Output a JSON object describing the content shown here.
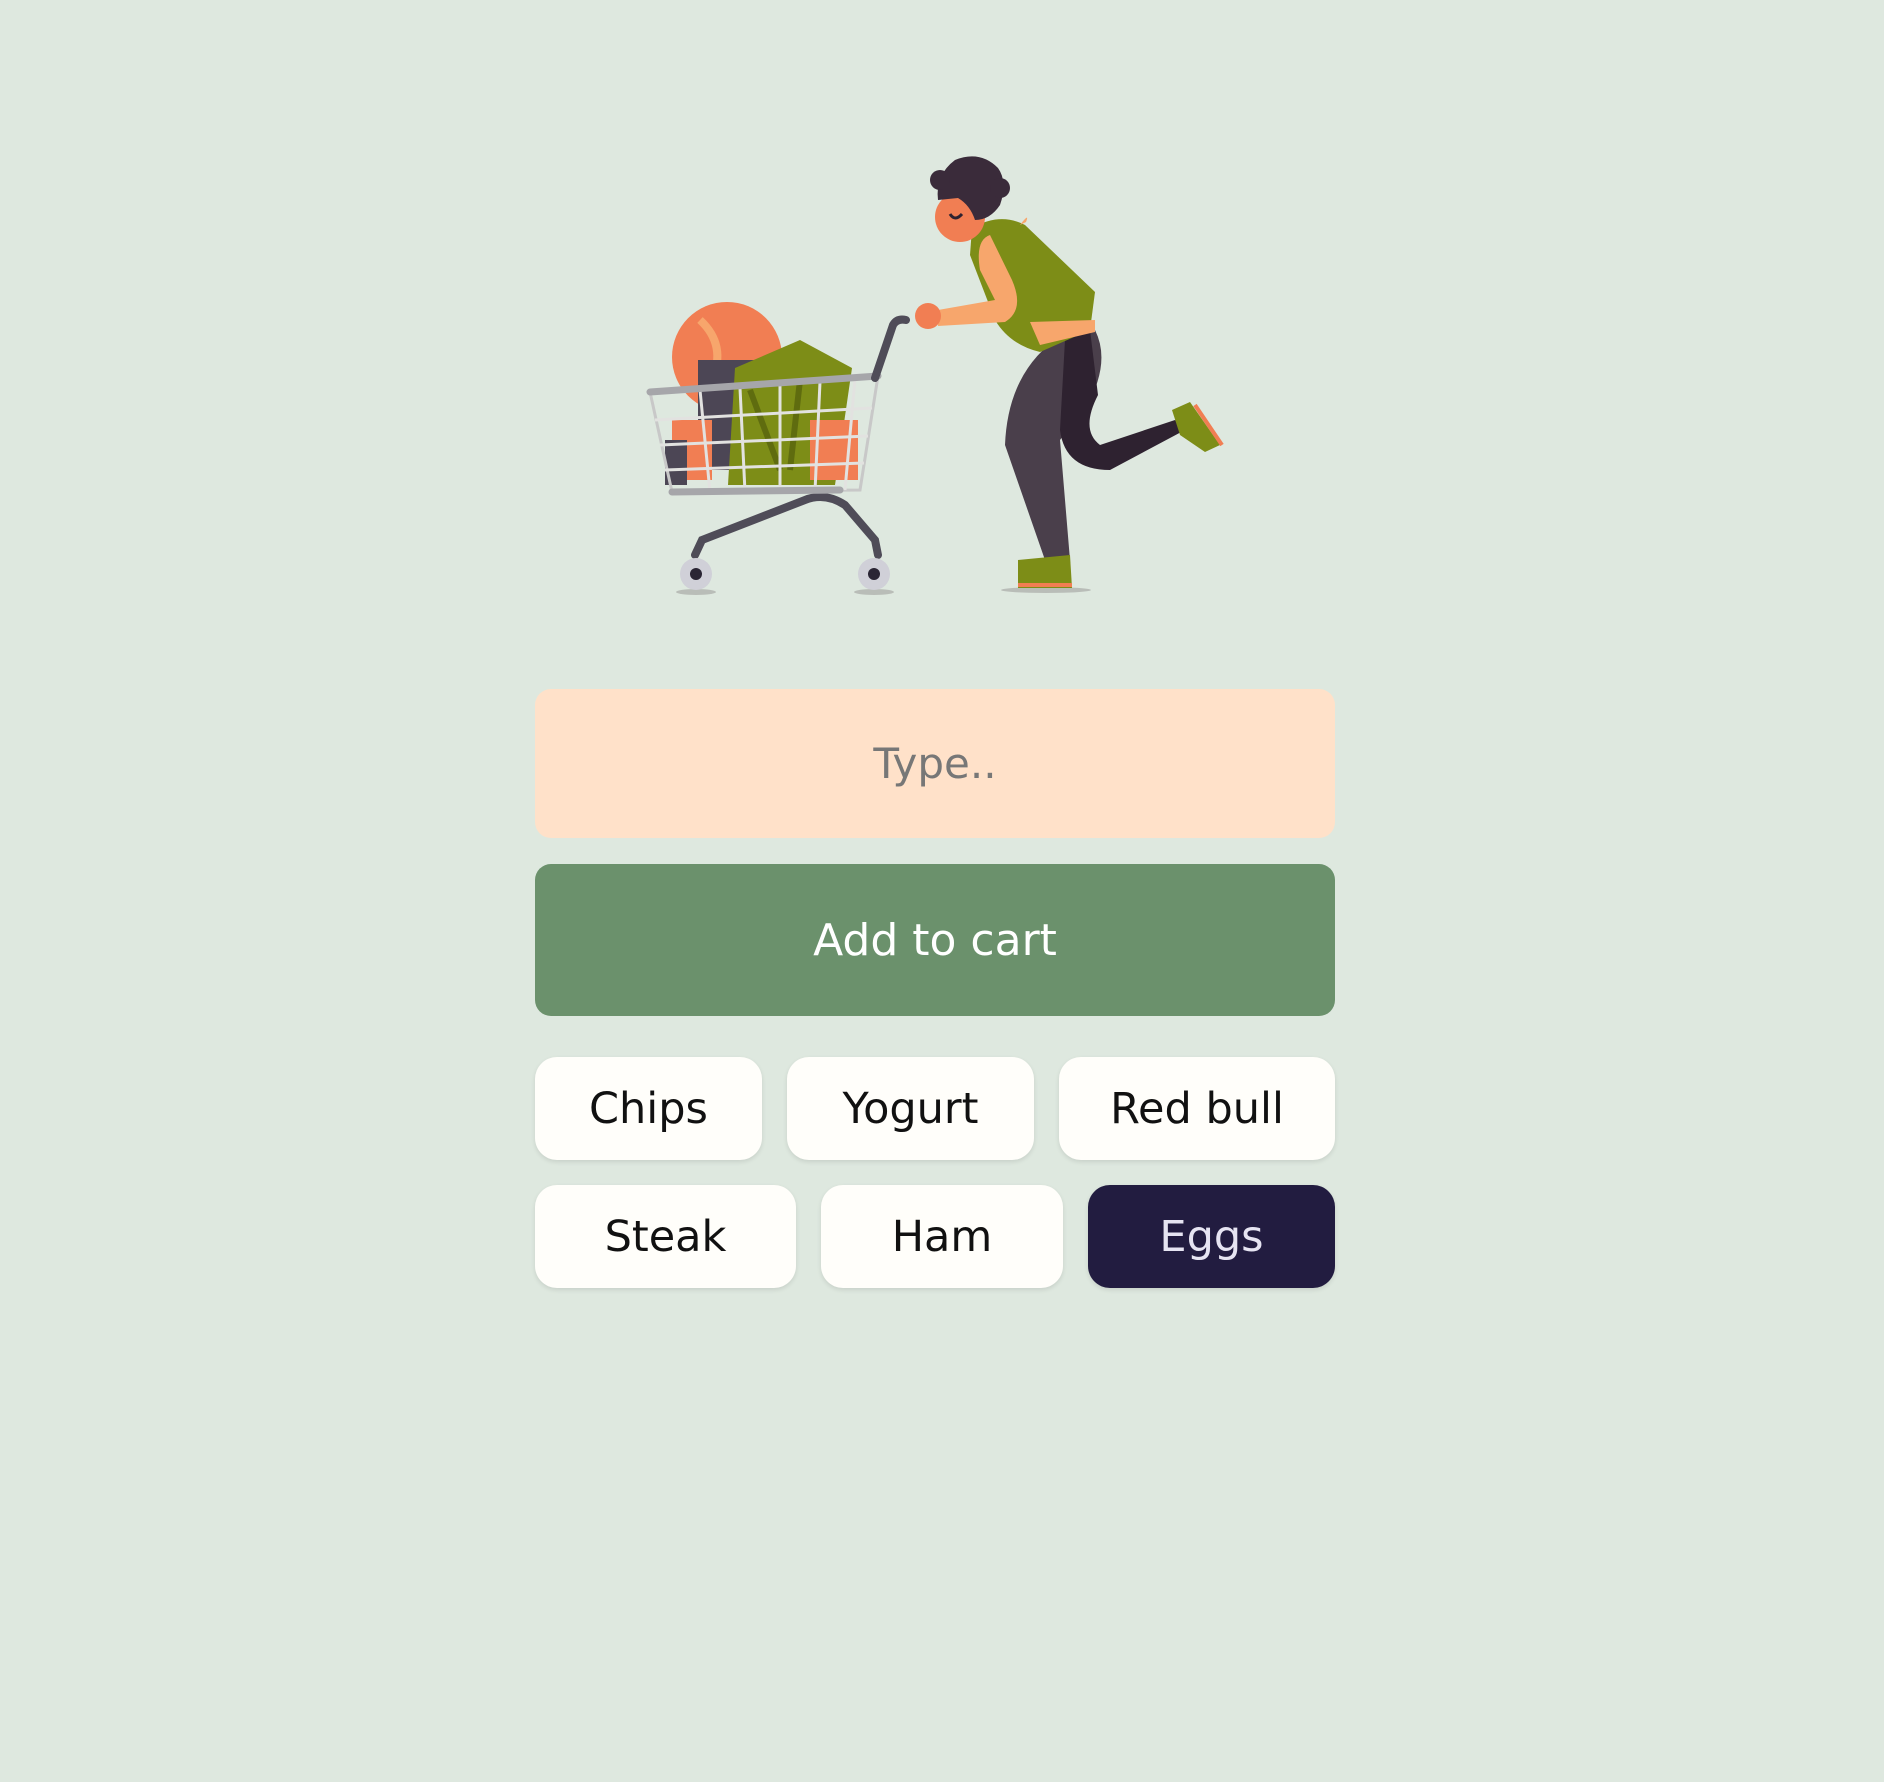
{
  "form": {
    "input_placeholder": "Type..",
    "input_value": "",
    "add_button_label": "Add to cart"
  },
  "items": [
    {
      "label": "Chips",
      "selected": false
    },
    {
      "label": "Yogurt",
      "selected": false
    },
    {
      "label": "Red bull",
      "selected": false
    },
    {
      "label": "Steak",
      "selected": false
    },
    {
      "label": "Ham",
      "selected": false
    },
    {
      "label": "Eggs",
      "selected": true
    }
  ],
  "colors": {
    "background": "#dee8df",
    "input_background": "#ffe1c9",
    "button_background": "#6b916c",
    "chip_background": "#fffefa",
    "chip_selected_background": "#221c40"
  },
  "illustration": {
    "icon": "person-pushing-shopping-cart-illustration"
  }
}
